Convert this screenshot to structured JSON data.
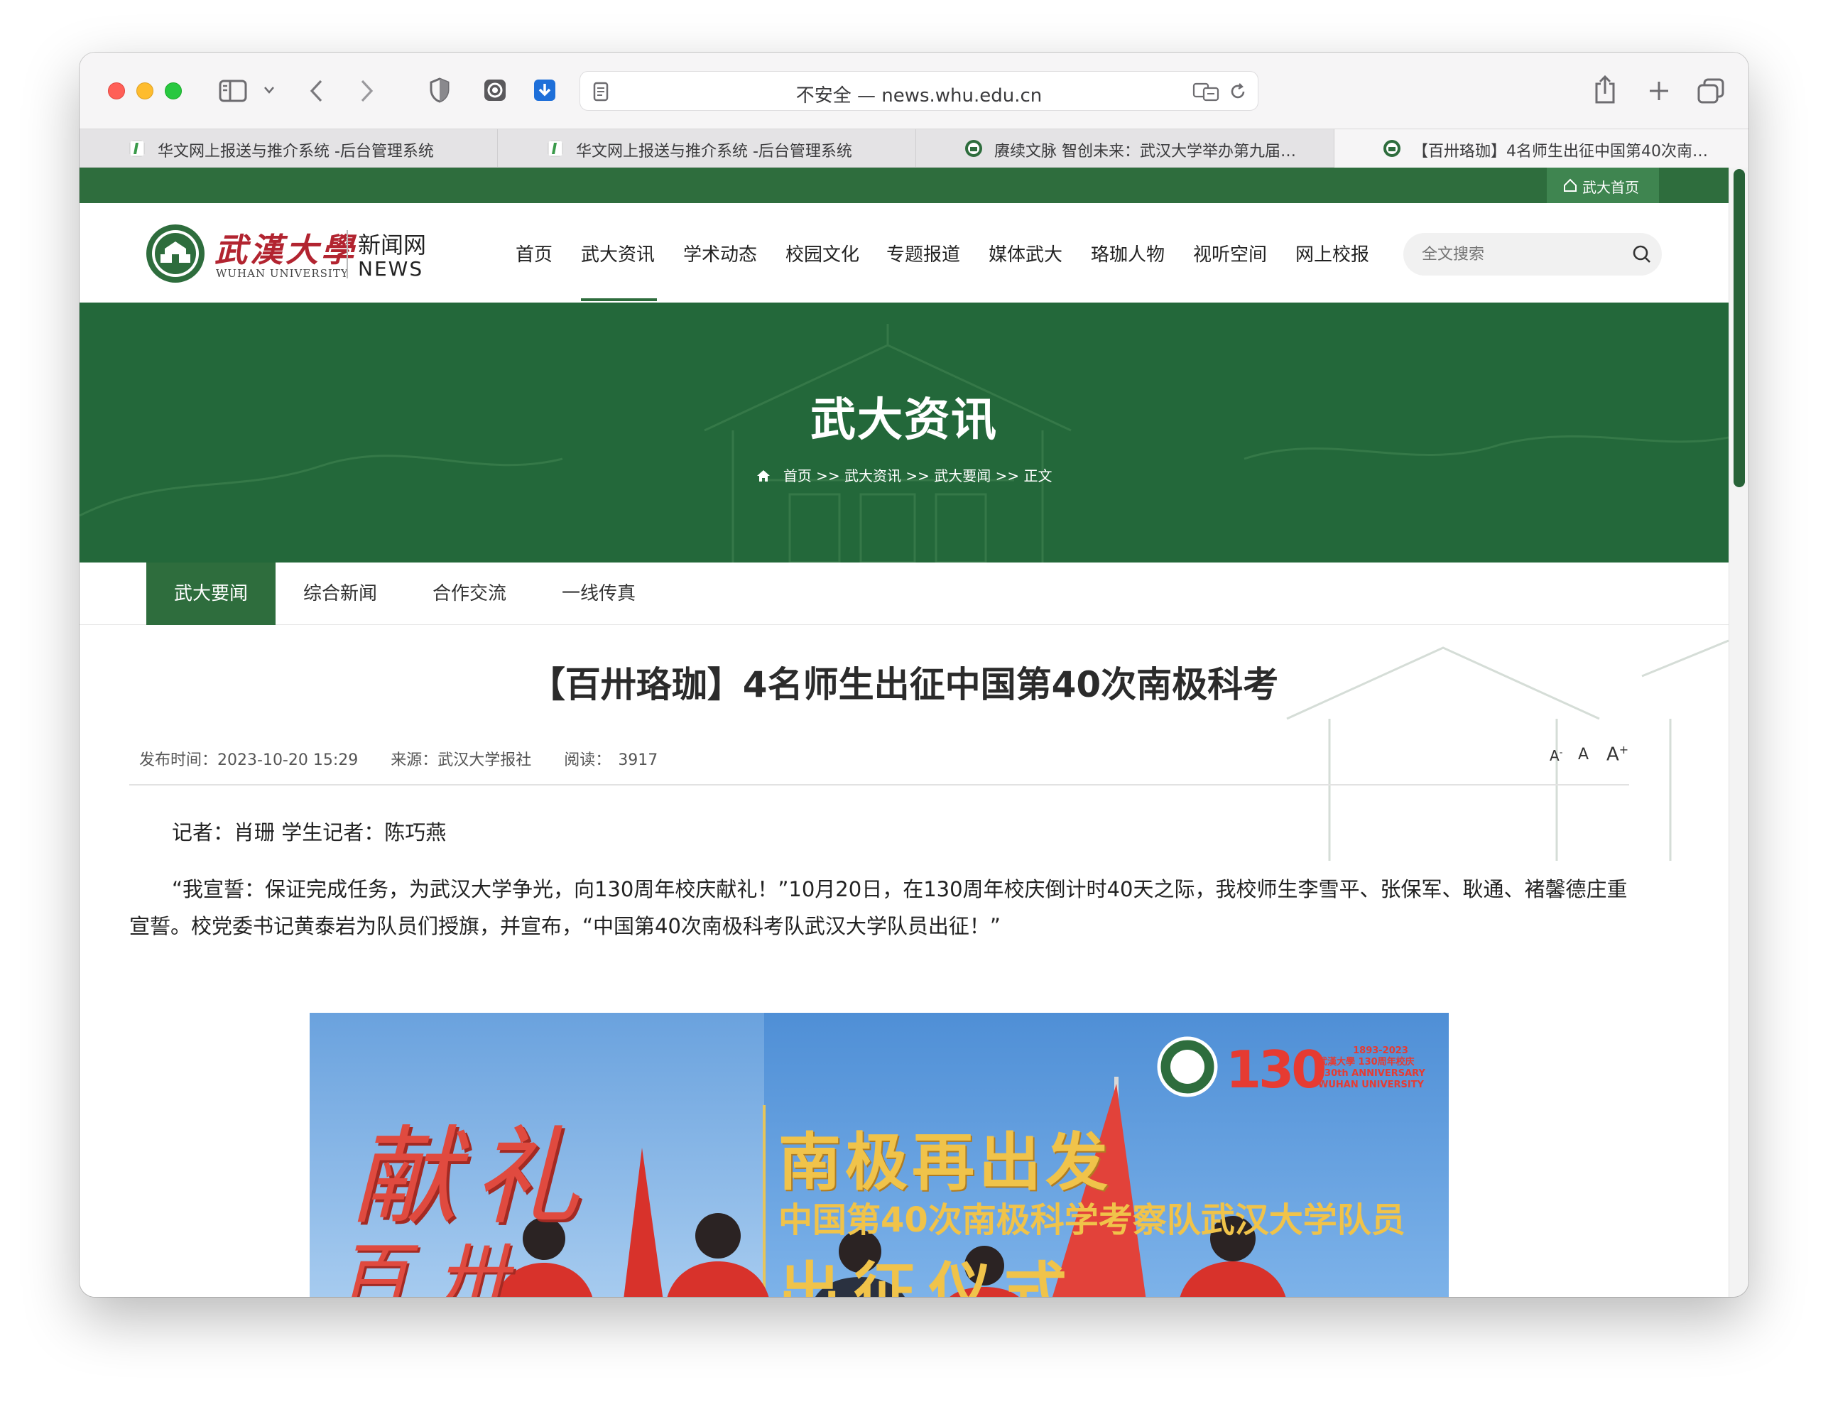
{
  "browser": {
    "url": "不安全 — news.whu.edu.cn",
    "tabs": [
      {
        "label": "华文网上报送与推介系统 -后台管理系统"
      },
      {
        "label": "华文网上报送与推介系统 -后台管理系统"
      },
      {
        "label": "赓续文脉 智创未来：武汉大学举办第九届…"
      },
      {
        "label": "【百卅珞珈】4名师生出征中国第40次南…"
      }
    ]
  },
  "site": {
    "home_link": "武大首页",
    "logo_cn": "武漢大學",
    "logo_en": "WUHAN UNIVERSITY",
    "logo_news_cn": "新闻网",
    "logo_news_en": "NEWS",
    "nav": [
      "首页",
      "武大资讯",
      "学术动态",
      "校园文化",
      "专题报道",
      "媒体武大",
      "珞珈人物",
      "视听空间",
      "网上校报"
    ],
    "search_placeholder": "全文搜索",
    "banner_title": "武大资讯",
    "breadcrumb": "首页 >> 武大资讯 >> 武大要闻 >> 正文",
    "subnav": [
      "武大要闻",
      "综合新闻",
      "合作交流",
      "一线传真"
    ],
    "colors": {
      "brand_green": "#2e6d3d",
      "banner_green": "#23683a"
    }
  },
  "article": {
    "title": "【百卅珞珈】4名师生出征中国第40次南极科考",
    "publish_label": "发布时间：",
    "publish_time": "2023-10-20 15:29",
    "source_label": "来源：",
    "source": "武汉大学报社",
    "reads_label": "阅读：",
    "reads": "3917",
    "font_small": "A",
    "font_normal": "A",
    "font_large": "A",
    "reporter": "记者：肖珊  学生记者：陈巧燕",
    "paragraph1": "“我宣誓：保证完成任务，为武汉大学争光，向130周年校庆献礼！”10月20日，在130周年校庆倒计时40天之际，我校师生李雪平、张保军、耿通、褚馨德庄重宣誓。校党委书记黄泰岩为队员们授旗，并宣布，“中国第40次南极科考队武汉大学队员出征！”",
    "photo": {
      "banner_line1": "南极再出发",
      "banner_line2": "中国第40次南极科学考察队武汉大学队员",
      "banner_line3": "出征仪式",
      "calligraphy_1": "献礼",
      "calligraphy_2": "百卅",
      "anniversary_number": "130",
      "anniversary_cn": "武漢大學 130周年校庆",
      "anniversary_years": "1893-2023",
      "anniversary_en1": "130th ANNIVERSARY",
      "anniversary_en2": "WUHAN UNIVERSITY"
    }
  }
}
